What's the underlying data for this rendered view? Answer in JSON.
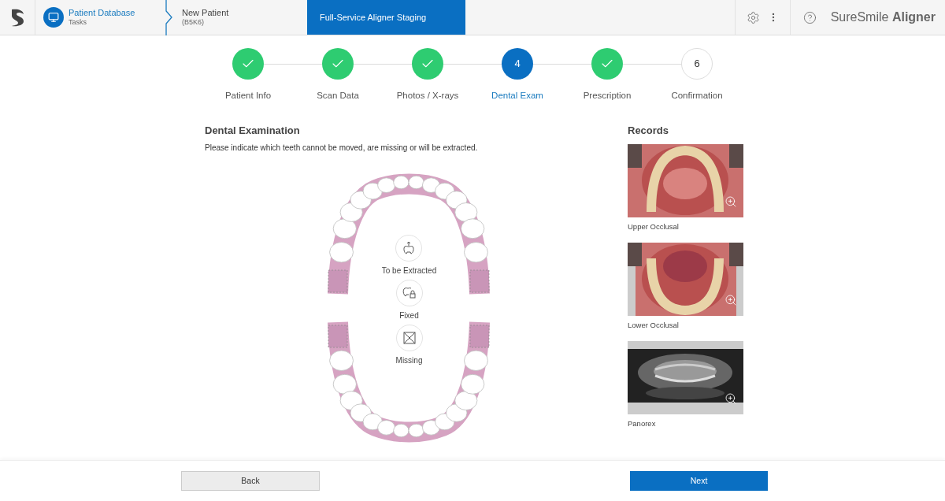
{
  "breadcrumbs": [
    {
      "title": "Patient Database",
      "subtitle": "Tasks"
    },
    {
      "title": "New Patient",
      "subtitle": "(B5K6)"
    }
  ],
  "active_tab": {
    "label": "Full-Service Aligner Staging"
  },
  "brand": "SureSmile **Aligner**",
  "steps": [
    {
      "label": "Patient Info",
      "completed": true,
      "selected": false
    },
    {
      "label": "Scan Data",
      "completed": true,
      "selected": false
    },
    {
      "label": "Photos / X-rays",
      "completed": true,
      "selected": false
    },
    {
      "label": "Dental Exam",
      "completed": false,
      "selected": true,
      "number": "4"
    },
    {
      "label": "Prescription",
      "completed": true,
      "selected": false
    },
    {
      "label": "Confirmation",
      "completed": false,
      "selected": false,
      "number": "6"
    }
  ],
  "exam": {
    "title": "Dental Examination",
    "instruction": "Please indicate which teeth cannot be moved, are missing or will be extracted.",
    "legend": [
      {
        "kind": "extract",
        "label": "To be Extracted"
      },
      {
        "kind": "fixed",
        "label": "Fixed"
      },
      {
        "kind": "missing",
        "label": "Missing"
      }
    ]
  },
  "records": {
    "title": "Records",
    "items": [
      {
        "kind": "upper",
        "caption": "Upper Occlusal"
      },
      {
        "kind": "lower",
        "caption": "Lower Occlusal"
      },
      {
        "kind": "xray",
        "caption": "Panorex"
      }
    ]
  },
  "footer": {
    "back": "Back",
    "next": "Next"
  }
}
